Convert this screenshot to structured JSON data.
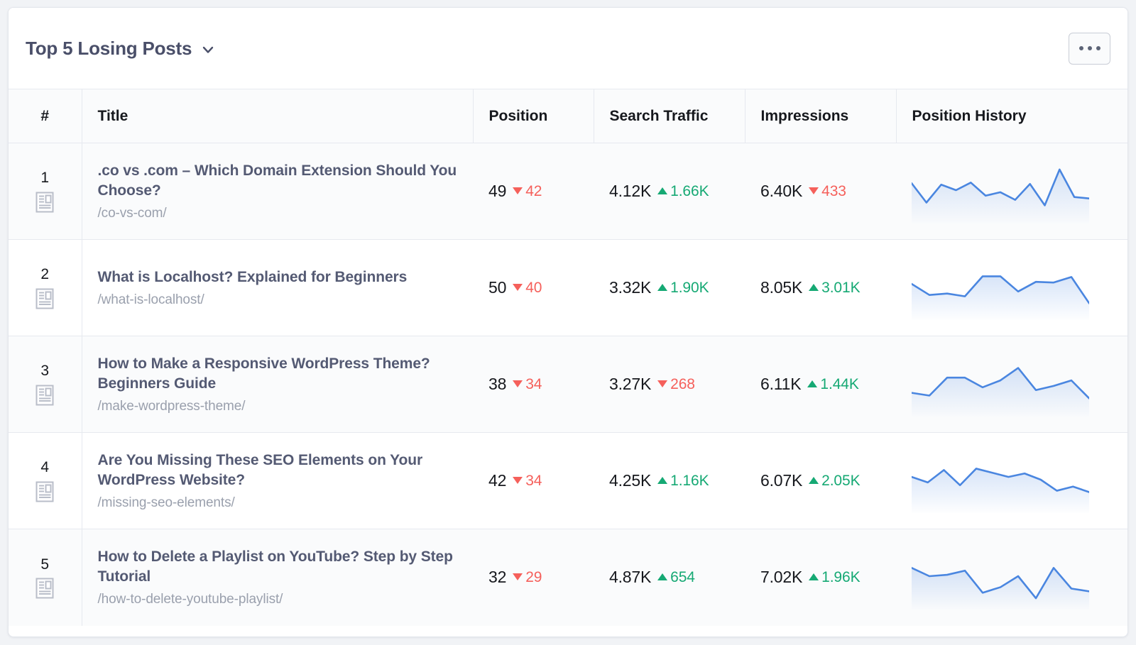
{
  "header": {
    "title": "Top 5 Losing Posts",
    "dropdown_icon": "chevron-down-icon",
    "menu_button_label": "•••"
  },
  "table": {
    "columns": [
      "#",
      "Title",
      "Position",
      "Search Traffic",
      "Impressions",
      "Position History"
    ],
    "rows": [
      {
        "rank": "1",
        "title": ".co vs .com – Which Domain Extension Should You Choose?",
        "url": "/co-vs-com/",
        "position": {
          "value": "49",
          "delta": "42",
          "dir": "down"
        },
        "search_traffic": {
          "value": "4.12K",
          "delta": "1.66K",
          "dir": "up"
        },
        "impressions": {
          "value": "6.40K",
          "delta": "433",
          "dir": "down"
        }
      },
      {
        "rank": "2",
        "title": "What is Localhost? Explained for Beginners",
        "url": "/what-is-localhost/",
        "position": {
          "value": "50",
          "delta": "40",
          "dir": "down"
        },
        "search_traffic": {
          "value": "3.32K",
          "delta": "1.90K",
          "dir": "up"
        },
        "impressions": {
          "value": "8.05K",
          "delta": "3.01K",
          "dir": "up"
        }
      },
      {
        "rank": "3",
        "title": "How to Make a Responsive WordPress Theme? Beginners Guide",
        "url": "/make-wordpress-theme/",
        "position": {
          "value": "38",
          "delta": "34",
          "dir": "down"
        },
        "search_traffic": {
          "value": "3.27K",
          "delta": "268",
          "dir": "down"
        },
        "impressions": {
          "value": "6.11K",
          "delta": "1.44K",
          "dir": "up"
        }
      },
      {
        "rank": "4",
        "title": "Are You Missing These SEO Elements on Your WordPress Website?",
        "url": "/missing-seo-elements/",
        "position": {
          "value": "42",
          "delta": "34",
          "dir": "down"
        },
        "search_traffic": {
          "value": "4.25K",
          "delta": "1.16K",
          "dir": "up"
        },
        "impressions": {
          "value": "6.07K",
          "delta": "2.05K",
          "dir": "up"
        }
      },
      {
        "rank": "5",
        "title": "How to Delete a Playlist on YouTube? Step by Step Tutorial",
        "url": "/how-to-delete-youtube-playlist/",
        "position": {
          "value": "32",
          "delta": "29",
          "dir": "down"
        },
        "search_traffic": {
          "value": "4.87K",
          "delta": "654",
          "dir": "up"
        },
        "impressions": {
          "value": "7.02K",
          "delta": "1.96K",
          "dir": "up"
        }
      }
    ]
  },
  "colors": {
    "up": "#16a974",
    "down": "#f5605b",
    "sparkline": "#4a86e0",
    "title_text": "#545a73",
    "url_text": "#9aa0ad"
  },
  "chart_data": [
    {
      "type": "line",
      "title": "Position History – row 1",
      "y": [
        46,
        18,
        44,
        36,
        47,
        28,
        33,
        22,
        45,
        14,
        66,
        26,
        24
      ],
      "ylim": [
        0,
        72
      ]
    },
    {
      "type": "line",
      "title": "Position History – row 2",
      "y": [
        40,
        24,
        26,
        22,
        51,
        51,
        29,
        43,
        42,
        50,
        12
      ],
      "ylim": [
        0,
        72
      ]
    },
    {
      "type": "line",
      "title": "Position History – row 3",
      "y": [
        22,
        18,
        44,
        44,
        30,
        40,
        58,
        26,
        32,
        40,
        14
      ],
      "ylim": [
        0,
        72
      ]
    },
    {
      "type": "line",
      "title": "Position History – row 4",
      "y": [
        40,
        32,
        50,
        28,
        52,
        46,
        40,
        45,
        36,
        20,
        26,
        18
      ],
      "ylim": [
        0,
        72
      ]
    },
    {
      "type": "line",
      "title": "Position History – row 5",
      "y": [
        48,
        36,
        38,
        44,
        12,
        20,
        36,
        4,
        48,
        18,
        14
      ],
      "ylim": [
        0,
        72
      ]
    }
  ]
}
